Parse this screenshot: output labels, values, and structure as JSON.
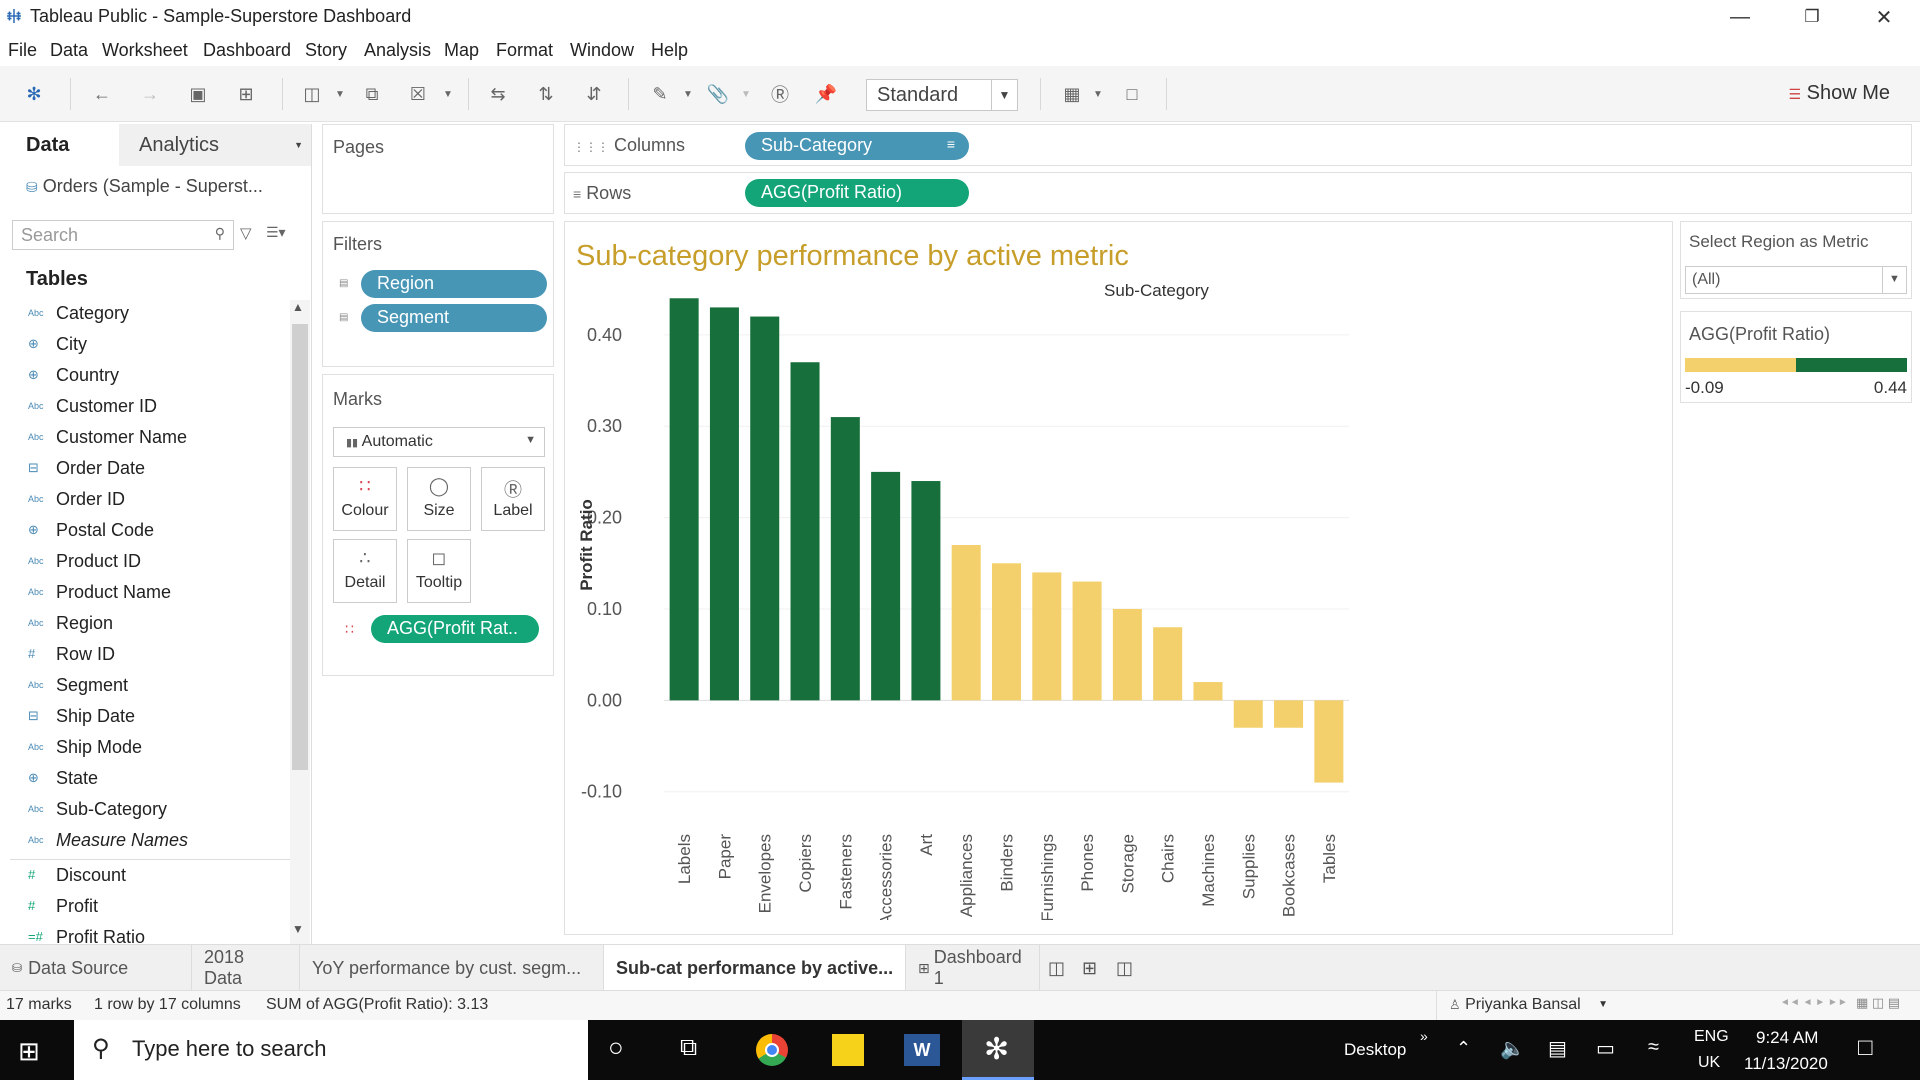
{
  "window": {
    "title": "Tableau Public - Sample-Superstore Dashboard"
  },
  "menu": [
    "File",
    "Data",
    "Worksheet",
    "Dashboard",
    "Story",
    "Analysis",
    "Map",
    "Format",
    "Window",
    "Help"
  ],
  "toolbar": {
    "fit_select": "Standard",
    "show_me": "Show Me"
  },
  "data_pane": {
    "tab_data": "Data",
    "tab_analytics": "Analytics",
    "datasource": "Orders (Sample - Superst...",
    "search_placeholder": "Search",
    "tables_heading": "Tables",
    "fields": [
      {
        "name": "Category",
        "icon": "Abc"
      },
      {
        "name": "City",
        "icon": "globe"
      },
      {
        "name": "Country",
        "icon": "globe"
      },
      {
        "name": "Customer ID",
        "icon": "Abc"
      },
      {
        "name": "Customer Name",
        "icon": "Abc"
      },
      {
        "name": "Order Date",
        "icon": "calendar"
      },
      {
        "name": "Order ID",
        "icon": "Abc"
      },
      {
        "name": "Postal Code",
        "icon": "globe"
      },
      {
        "name": "Product ID",
        "icon": "Abc"
      },
      {
        "name": "Product Name",
        "icon": "Abc"
      },
      {
        "name": "Region",
        "icon": "Abc"
      },
      {
        "name": "Row ID",
        "icon": "#"
      },
      {
        "name": "Segment",
        "icon": "Abc"
      },
      {
        "name": "Ship Date",
        "icon": "calendar"
      },
      {
        "name": "Ship Mode",
        "icon": "Abc"
      },
      {
        "name": "State",
        "icon": "globe"
      },
      {
        "name": "Sub-Category",
        "icon": "Abc"
      },
      {
        "name": "Measure Names",
        "icon": "Abc"
      },
      {
        "name": "Discount",
        "icon": "#"
      },
      {
        "name": "Profit",
        "icon": "#"
      },
      {
        "name": "Profit Ratio",
        "icon": "=#"
      }
    ]
  },
  "pages_label": "Pages",
  "filters": {
    "label": "Filters",
    "pills": [
      "Region",
      "Segment"
    ]
  },
  "marks": {
    "label": "Marks",
    "type": "Automatic",
    "buttons": [
      "Colour",
      "Size",
      "Label",
      "Detail",
      "Tooltip"
    ],
    "pill": "AGG(Profit Rat.."
  },
  "shelves": {
    "columns_label": "Columns",
    "columns_pill": "Sub-Category",
    "rows_label": "Rows",
    "rows_pill": "AGG(Profit Ratio)"
  },
  "view_title": "Sub-category performance by active metric",
  "legend": {
    "param_title": "Select Region as Metric",
    "param_value": "(All)",
    "color_title": "AGG(Profit Ratio)",
    "min": "-0.09",
    "max": "0.44",
    "colors": {
      "low": "#f3d06b",
      "high": "#17703b"
    }
  },
  "chart_data": {
    "type": "bar",
    "title": "",
    "xlabel": "Sub-Category",
    "ylabel": "Profit Ratio",
    "ylim": [
      -0.12,
      0.46
    ],
    "yticks": [
      "0.40",
      "0.30",
      "0.20",
      "0.10",
      "0.00",
      "-0.10"
    ],
    "ytick_values": [
      0.4,
      0.3,
      0.2,
      0.1,
      0.0,
      -0.1
    ],
    "categories": [
      "Labels",
      "Paper",
      "Envelopes",
      "Copiers",
      "Fasteners",
      "Accessories",
      "Art",
      "Appliances",
      "Binders",
      "Furnishings",
      "Phones",
      "Storage",
      "Chairs",
      "Machines",
      "Supplies",
      "Bookcases",
      "Tables"
    ],
    "values": [
      0.44,
      0.43,
      0.42,
      0.37,
      0.31,
      0.25,
      0.24,
      0.17,
      0.15,
      0.14,
      0.13,
      0.1,
      0.08,
      0.02,
      -0.03,
      -0.03,
      -0.09
    ],
    "colors": [
      "#17703b",
      "#17703b",
      "#17703b",
      "#17703b",
      "#17703b",
      "#17703b",
      "#17703b",
      "#f3d06b",
      "#f3d06b",
      "#f3d06b",
      "#f3d06b",
      "#f3d06b",
      "#f3d06b",
      "#f3d06b",
      "#f3d06b",
      "#f3d06b",
      "#f3d06b"
    ]
  },
  "sheet_tabs": [
    "Data Source",
    "2018 Data",
    "YoY performance by cust. segm...",
    "Sub-cat performance by active...",
    "Dashboard 1"
  ],
  "status": {
    "marks": "17 marks",
    "shape": "1 row by 17 columns",
    "sum": "SUM of AGG(Profit Ratio): 3.13",
    "user": "Priyanka Bansal"
  },
  "taskbar": {
    "search_placeholder": "Type here to search",
    "desktop": "Desktop",
    "lang1": "ENG",
    "lang2": "UK",
    "time": "9:24 AM",
    "date": "11/13/2020"
  }
}
